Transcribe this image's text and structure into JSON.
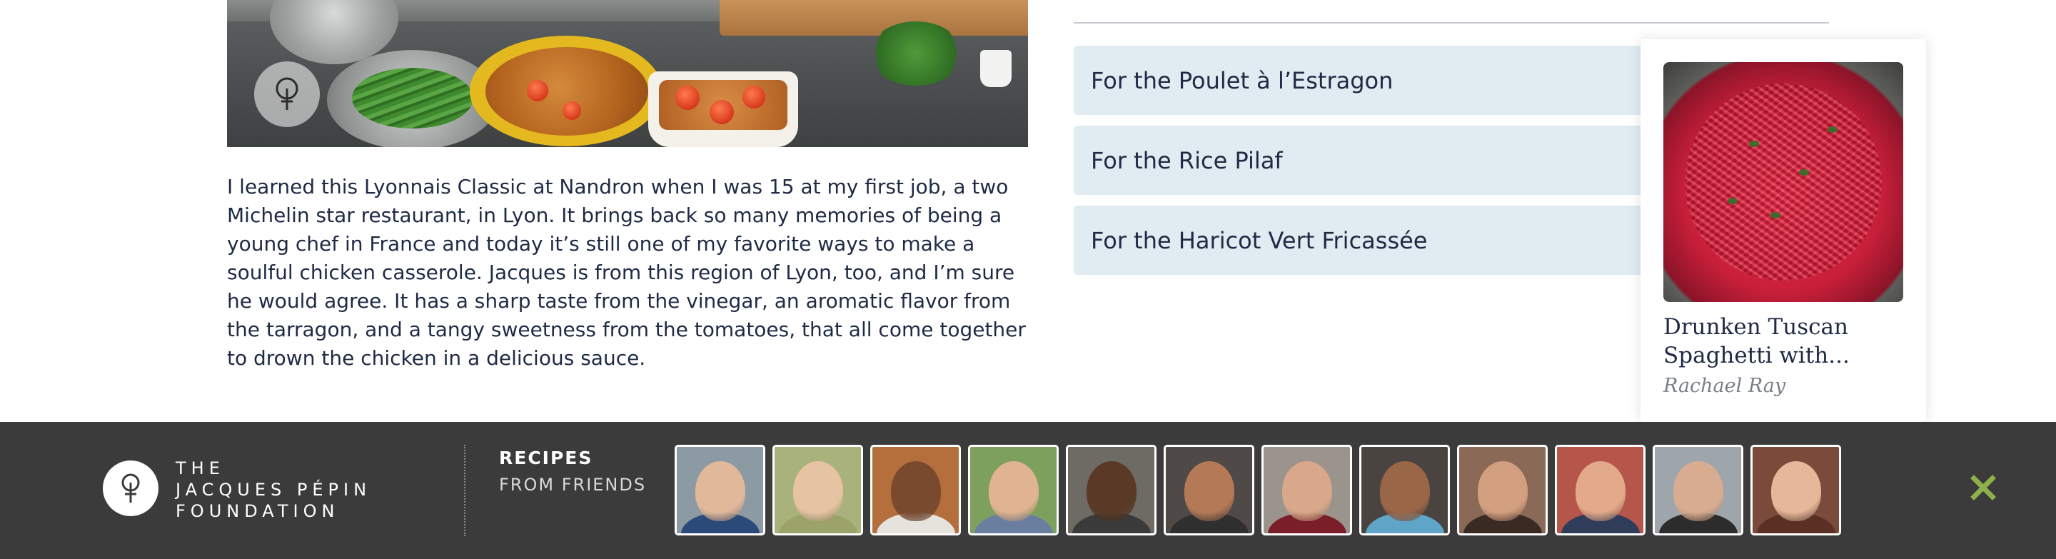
{
  "article": {
    "story_text": "I learned this Lyonnais Classic at Nandron when I was 15 at my first job, a two Michelin star restaurant, in Lyon. It brings back so many memories of being a young chef in France and today it’s still one of my favorite ways to make a soulful chicken casserole. Jacques is from this region of Lyon, too, and I’m sure he would agree. It has a sharp taste from the vinegar, an aromatic flavor from the tarragon, and a tangy sweetness from the tomatoes, that all come together to drown the chicken in a delicious sauce."
  },
  "ingredient_sections": [
    {
      "label": "For the Poulet à l’Estragon"
    },
    {
      "label": "For the Rice Pilaf"
    },
    {
      "label": "For the Haricot Vert Fricassée"
    }
  ],
  "related_card": {
    "title": "Drunken Tuscan Spaghetti with...",
    "author": "Rachael Ray"
  },
  "footer": {
    "foundation_name": [
      "THE",
      "JACQUES PÉPIN",
      "FOUNDATION"
    ],
    "recipes_title": "RECIPES",
    "recipes_subtitle": "FROM FRIENDS",
    "friends": [
      {
        "icon": "chef-portrait",
        "skin": "#e2b89a",
        "shirt": "#2b4a7a",
        "bg": "#8b9aa3"
      },
      {
        "icon": "chef-portrait",
        "skin": "#e6c3a3",
        "shirt": "#9ca36a",
        "bg": "#a9b27a"
      },
      {
        "icon": "chef-portrait",
        "skin": "#7a4a2e",
        "shirt": "#e6e2dc",
        "bg": "#b46f3c"
      },
      {
        "icon": "chef-portrait",
        "skin": "#e0b492",
        "shirt": "#6a7fa0",
        "bg": "#7ea05f"
      },
      {
        "icon": "chef-portrait",
        "skin": "#5a3a26",
        "shirt": "#3a3a3a",
        "bg": "#6e6a64"
      },
      {
        "icon": "chef-portrait",
        "skin": "#b47a58",
        "shirt": "#2f2f2f",
        "bg": "#4f4a47"
      },
      {
        "icon": "chef-portrait",
        "skin": "#d9a88a",
        "shirt": "#7a1f2a",
        "bg": "#9a948c"
      },
      {
        "icon": "chef-portrait",
        "skin": "#9a6648",
        "shirt": "#5fa5c8",
        "bg": "#4a4440"
      },
      {
        "icon": "chef-portrait",
        "skin": "#d2a080",
        "shirt": "#3a2a24",
        "bg": "#8a6a56"
      },
      {
        "icon": "chef-portrait",
        "skin": "#e2a98a",
        "shirt": "#2f3d5a",
        "bg": "#b6564a"
      },
      {
        "icon": "chef-portrait",
        "skin": "#d8ac90",
        "shirt": "#2c2c2c",
        "bg": "#9fa6ab"
      },
      {
        "icon": "chef-portrait",
        "skin": "#e6b89a",
        "shirt": "#5a3024",
        "bg": "#7a4a3a"
      }
    ],
    "close_icon": "close-x-icon",
    "colors": {
      "bar": "#3b3b3b",
      "close": "#8db04a"
    }
  }
}
